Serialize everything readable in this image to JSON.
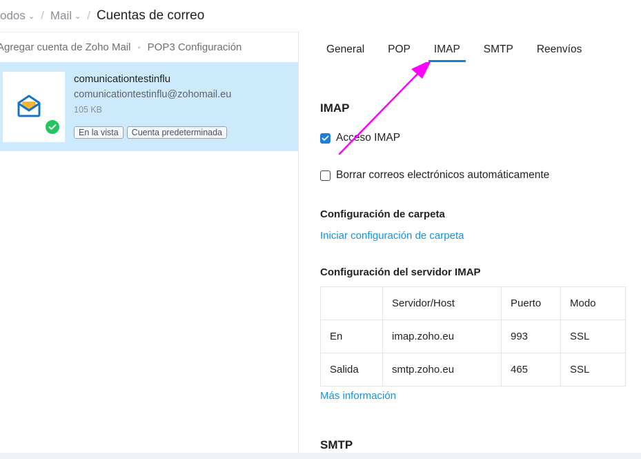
{
  "breadcrumb": {
    "item1": "odos",
    "item2": "Mail",
    "current": "Cuentas de correo",
    "separator": "/"
  },
  "left_toolbar": {
    "add_account": "Agregar cuenta de Zoho Mail",
    "dot": "•",
    "pop3_config": "POP3 Configuración"
  },
  "account": {
    "name": "comunicationtestinflu",
    "email": "comunicationtestinflu@zohomail.eu",
    "size": "105 KB",
    "tags": [
      "En la vista",
      "Cuenta predeterminada"
    ]
  },
  "tabs": [
    "General",
    "POP",
    "IMAP",
    "SMTP",
    "Reenvíos"
  ],
  "active_tab": "IMAP",
  "content": {
    "cut_link": "Más información",
    "imap_title": "IMAP",
    "imap_access_label": "Acceso IMAP",
    "imap_access_checked": true,
    "auto_delete_label": "Borrar correos electrónicos automáticamente",
    "auto_delete_checked": false,
    "folder_config_title": "Configuración de carpeta",
    "folder_config_link": "Iniciar configuración de carpeta",
    "server_config_title": "Configuración del servidor IMAP",
    "table": {
      "headers": [
        "",
        "Servidor/Host",
        "Puerto",
        "Modo"
      ],
      "rows": [
        [
          "En",
          "imap.zoho.eu",
          "993",
          "SSL"
        ],
        [
          "Salida",
          "smtp.zoho.eu",
          "465",
          "SSL"
        ]
      ]
    },
    "more_info_link": "Más información",
    "smtp_title": "SMTP"
  },
  "colors": {
    "accent": "#1a7fd4",
    "link": "#1591e0",
    "selected_row": "#cdeafd",
    "badge_green": "#22c55e",
    "annotation_arrow": "#ff00ff"
  }
}
